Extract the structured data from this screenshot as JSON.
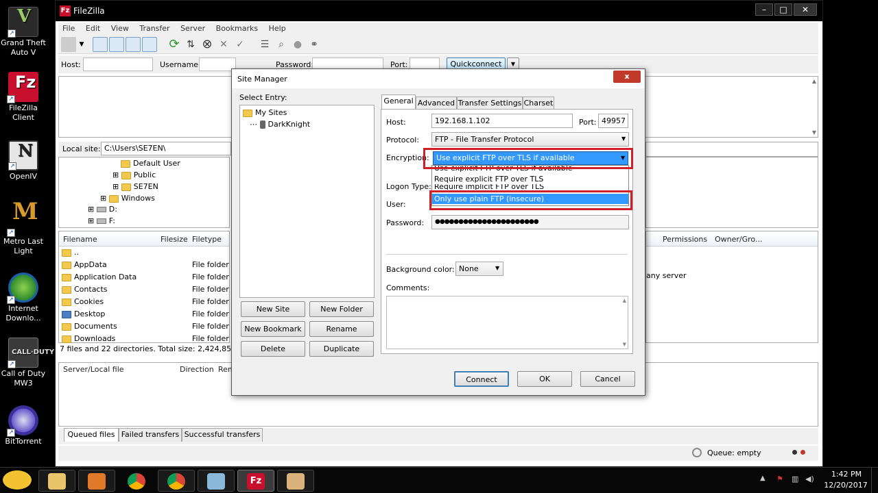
{
  "desktop": {
    "icons": [
      {
        "label": "Grand Theft Auto V"
      },
      {
        "label": "FileZilla Client"
      },
      {
        "label": "OpenIV"
      },
      {
        "label": "Metro Last Light"
      },
      {
        "label": "Internet Downlo..."
      },
      {
        "label": "Call of Duty MW3"
      },
      {
        "label": "BitTorrent"
      }
    ]
  },
  "filezilla": {
    "title": "FileZilla",
    "menu": [
      "File",
      "Edit",
      "View",
      "Transfer",
      "Server",
      "Bookmarks",
      "Help"
    ],
    "quickconnect": {
      "host_label": "Host:",
      "username_label": "Username:",
      "password_label": "Password:",
      "port_label": "Port:",
      "button": "Quickconnect"
    },
    "local_site_label": "Local site:",
    "local_site_path": "C:\\Users\\SE7EN\\",
    "tree": [
      "Default User",
      "Public",
      "SE7EN",
      "Windows",
      "D:",
      "F:"
    ],
    "file_headers": [
      "Filename",
      "Filesize",
      "Filetype"
    ],
    "files": [
      {
        "name": "..",
        "type": ""
      },
      {
        "name": "AppData",
        "type": "File folder"
      },
      {
        "name": "Application Data",
        "type": "File folder"
      },
      {
        "name": "Contacts",
        "type": "File folder"
      },
      {
        "name": "Cookies",
        "type": "File folder"
      },
      {
        "name": "Desktop",
        "type": "File folder"
      },
      {
        "name": "Documents",
        "type": "File folder"
      },
      {
        "name": "Downloads",
        "type": "File folder"
      }
    ],
    "status_summary": "7 files and 22 directories. Total size: 2,424,852 bytes",
    "remote_headers": [
      "Permissions",
      "Owner/Gro..."
    ],
    "remote_message": "any server",
    "queue_headers": [
      "Server/Local file",
      "Direction",
      "Rem"
    ],
    "bottom_tabs": [
      "Queued files",
      "Failed transfers",
      "Successful transfers"
    ],
    "queue_status": "Queue: empty"
  },
  "site_manager": {
    "title": "Site Manager",
    "close": "x",
    "select_entry_label": "Select Entry:",
    "tree_root": "My Sites",
    "tree_site": "DarkKnight",
    "buttons": {
      "new_site": "New Site",
      "new_folder": "New Folder",
      "new_bookmark": "New Bookmark",
      "rename": "Rename",
      "delete": "Delete",
      "duplicate": "Duplicate",
      "connect": "Connect",
      "ok": "OK",
      "cancel": "Cancel"
    },
    "tabs": [
      "General",
      "Advanced",
      "Transfer Settings",
      "Charset"
    ],
    "host_label": "Host:",
    "host_value": "192.168.1.102",
    "port_label": "Port:",
    "port_value": "49957",
    "protocol_label": "Protocol:",
    "protocol_value": "FTP - File Transfer Protocol",
    "encryption_label": "Encryption:",
    "encryption_value": "Use explicit FTP over TLS if available",
    "encryption_options": [
      "Use explicit FTP over TLS if available",
      "Require explicit FTP over TLS",
      "Require implicit FTP over TLS",
      "Only use plain FTP (insecure)"
    ],
    "logon_type_label": "Logon Type:",
    "user_label": "User:",
    "password_label": "Password:",
    "password_value": "●●●●●●●●●●●●●●●●●●●●●●",
    "background_color_label": "Background color:",
    "background_color_value": "None",
    "comments_label": "Comments:"
  },
  "taskbar": {
    "time": "1:42 PM",
    "date": "12/20/2017"
  },
  "colors": {
    "highlight_red": "#d11f2a",
    "selection_blue": "#3399ff"
  }
}
